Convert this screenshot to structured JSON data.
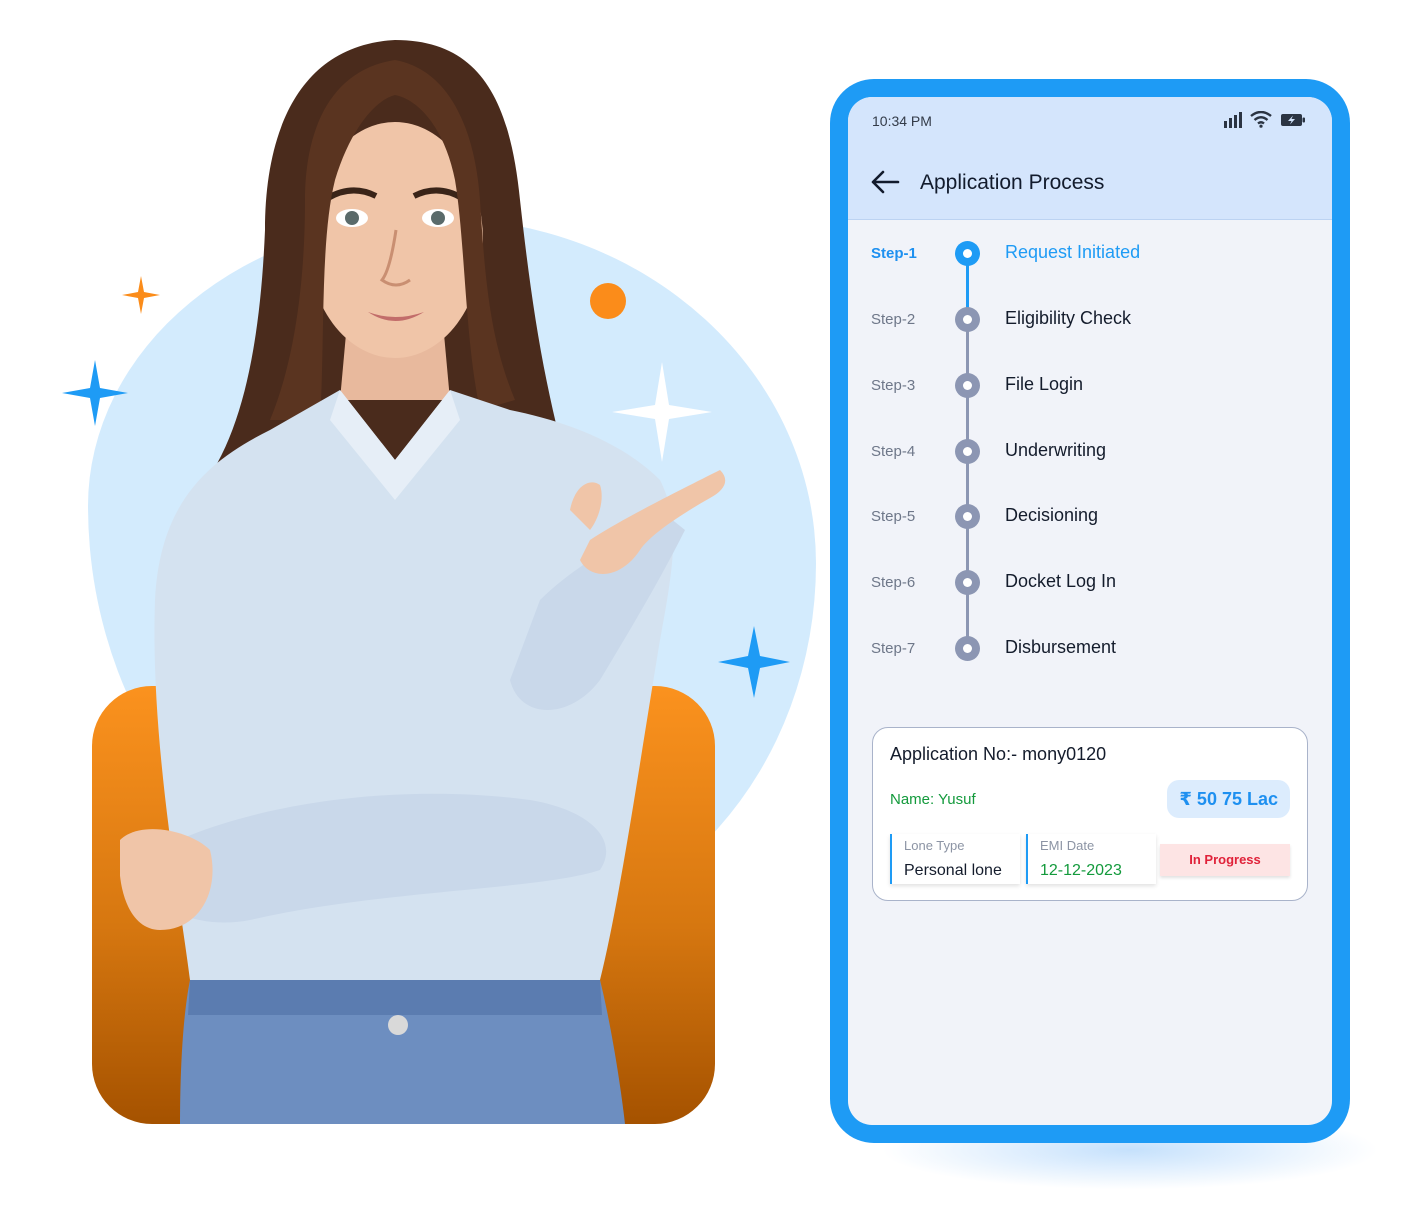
{
  "status_bar": {
    "time": "10:34 PM",
    "icons": [
      "signal-icon",
      "wifi-icon",
      "battery-charging-icon"
    ]
  },
  "appbar": {
    "back_icon": "arrow-left-icon",
    "title": "Application Process"
  },
  "steps": [
    {
      "label": "Step-1",
      "name": "Request Initiated",
      "active": true
    },
    {
      "label": "Step-2",
      "name": "Eligibility Check",
      "active": false
    },
    {
      "label": "Step-3",
      "name": "File Login",
      "active": false
    },
    {
      "label": "Step-4",
      "name": "Underwriting",
      "active": false
    },
    {
      "label": "Step-5",
      "name": "Decisioning",
      "active": false
    },
    {
      "label": "Step-6",
      "name": "Docket Log In",
      "active": false
    },
    {
      "label": "Step-7",
      "name": "Disbursement",
      "active": false
    }
  ],
  "application": {
    "number": "Application No:- mony0120",
    "name": "Name: Yusuf",
    "amount": "₹ 50 75 Lac",
    "loan_type_label": "Lone Type",
    "loan_type_value": "Personal lone",
    "emi_date_label": "EMI Date",
    "emi_date_value": "12-12-2023",
    "status": "In Progress"
  },
  "colors": {
    "accent": "#1e9bf5",
    "inactive_step": "#8c96b3",
    "success_text": "#139a3c",
    "status_text": "#e0223a",
    "status_bg": "#fde4e4",
    "orange": "#fb921e"
  }
}
